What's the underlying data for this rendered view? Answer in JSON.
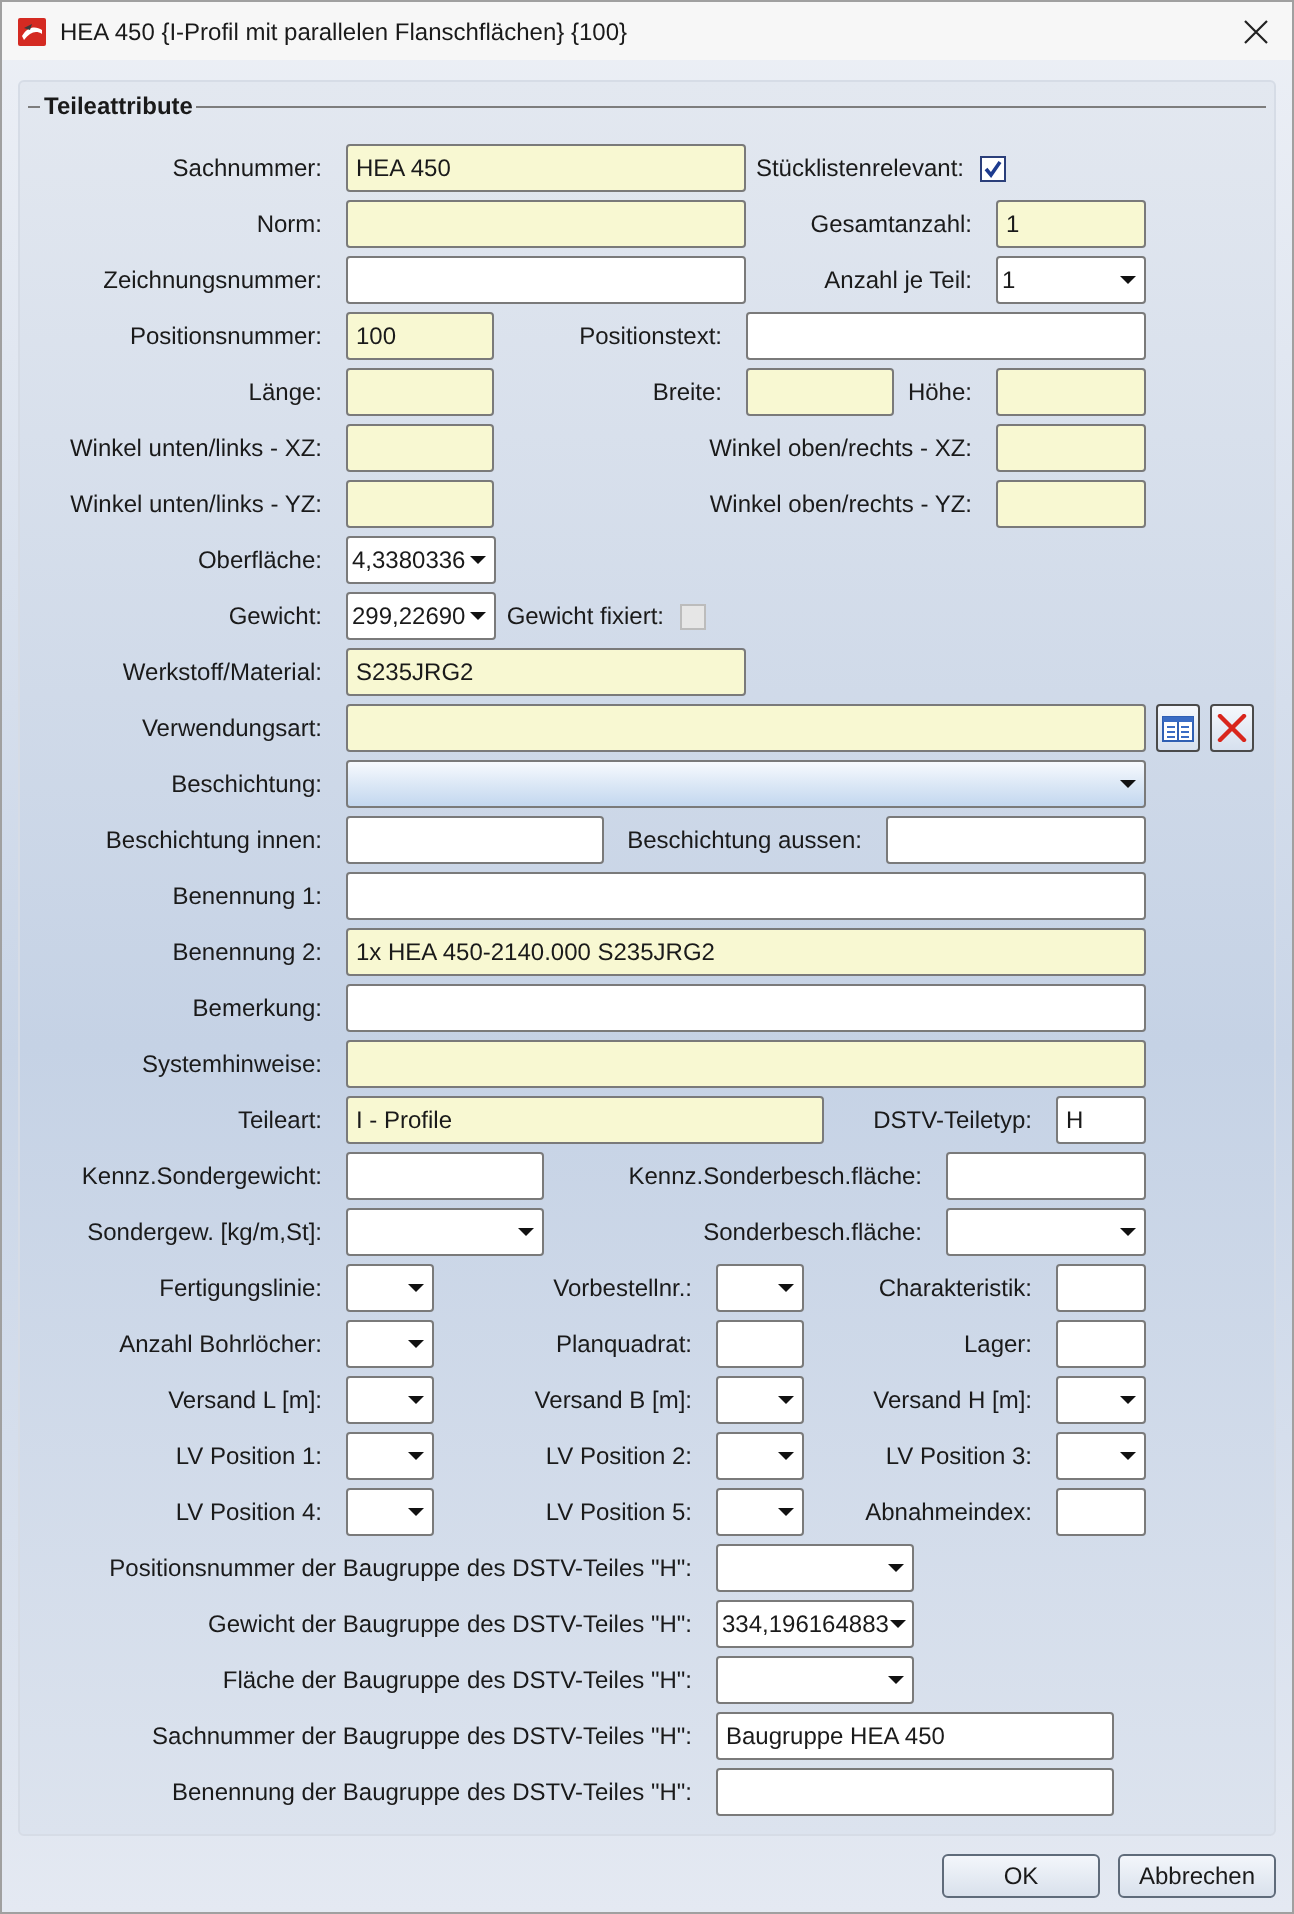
{
  "window": {
    "title": "HEA 450 {I-Profil mit parallelen Flanschflächen} {100}"
  },
  "group": {
    "title": "Teileattribute"
  },
  "rows": [
    {
      "fields": [
        {
          "label": "Sachnummer:",
          "kind": "text",
          "value": "HEA 450",
          "highlighted": true
        },
        {
          "label": "Stücklistenrelevant:",
          "kind": "check",
          "checked": true,
          "disabled": false
        }
      ]
    },
    {
      "fields": [
        {
          "label": "Norm:",
          "kind": "text",
          "highlighted": true
        },
        {
          "label": "Gesamtanzahl:",
          "kind": "text",
          "value": "1",
          "highlighted": true
        }
      ]
    },
    {
      "fields": [
        {
          "label": "Zeichnungsnummer:",
          "kind": "text",
          "highlighted": false
        },
        {
          "label": "Anzahl je Teil:",
          "kind": "combo",
          "value": "1",
          "focused": false
        }
      ]
    },
    {
      "fields": [
        {
          "label": "Positionsnummer:",
          "kind": "text",
          "value": "100",
          "highlighted": true
        },
        {
          "label": "Positionstext:",
          "kind": "text",
          "highlighted": false
        }
      ]
    },
    {
      "fields": [
        {
          "label": "Länge:",
          "kind": "text",
          "highlighted": true
        },
        {
          "label": "Breite:",
          "kind": "text",
          "highlighted": true
        },
        {
          "label": "Höhe:",
          "kind": "text",
          "highlighted": true
        }
      ]
    },
    {
      "fields": [
        {
          "label": "Winkel unten/links - XZ:",
          "kind": "text",
          "highlighted": true
        },
        {
          "label": "Winkel oben/rechts - XZ:",
          "kind": "text",
          "highlighted": true
        }
      ]
    },
    {
      "fields": [
        {
          "label": "Winkel unten/links - YZ:",
          "kind": "text",
          "highlighted": true
        },
        {
          "label": "Winkel oben/rechts - YZ:",
          "kind": "text",
          "highlighted": true
        }
      ]
    },
    {
      "fields": [
        {
          "label": "Oberfläche:",
          "kind": "combo",
          "value": "4,3380336",
          "focused": false
        }
      ]
    },
    {
      "fields": [
        {
          "label": "Gewicht:",
          "kind": "combo",
          "value": "299,22690",
          "focused": false
        },
        {
          "label": "Gewicht fixiert:",
          "kind": "check",
          "checked": false,
          "disabled": true
        }
      ]
    },
    {
      "fields": [
        {
          "label": "Werkstoff/Material:",
          "kind": "text",
          "value": "S235JRG2",
          "highlighted": true
        }
      ]
    },
    {
      "fields": [
        {
          "label": "Verwendungsart:",
          "kind": "text",
          "highlighted": true
        },
        {
          "kind": "picker"
        },
        {
          "kind": "clear"
        }
      ]
    },
    {
      "fields": [
        {
          "label": "Beschichtung:",
          "kind": "combo",
          "focused": true
        }
      ]
    },
    {
      "fields": [
        {
          "label": "Beschichtung innen:",
          "kind": "text",
          "highlighted": false
        },
        {
          "label": "Beschichtung aussen:",
          "kind": "text",
          "highlighted": false
        }
      ]
    },
    {
      "fields": [
        {
          "label": "Benennung 1:",
          "kind": "text",
          "highlighted": false
        }
      ]
    },
    {
      "fields": [
        {
          "label": "Benennung 2:",
          "kind": "text",
          "value": "1x HEA 450-2140.000 S235JRG2",
          "highlighted": true
        }
      ]
    },
    {
      "fields": [
        {
          "label": "Bemerkung:",
          "kind": "text",
          "highlighted": false
        }
      ]
    },
    {
      "fields": [
        {
          "label": "Systemhinweise:",
          "kind": "text",
          "highlighted": true
        }
      ]
    },
    {
      "fields": [
        {
          "label": "Teileart:",
          "kind": "text",
          "value": "I - Profile",
          "highlighted": true
        },
        {
          "label": "DSTV-Teiletyp:",
          "kind": "text",
          "value": "H",
          "highlighted": false
        }
      ]
    },
    {
      "fields": [
        {
          "label": "Kennz.Sondergewicht:",
          "kind": "text",
          "highlighted": false
        },
        {
          "label": "Kennz.Sonderbesch.fläche:",
          "kind": "text",
          "highlighted": false
        }
      ]
    },
    {
      "fields": [
        {
          "label": "Sondergew. [kg/m,St]:",
          "kind": "combo",
          "focused": false
        },
        {
          "label": "Sonderbesch.fläche:",
          "kind": "combo",
          "focused": false
        }
      ]
    },
    {
      "fields": [
        {
          "label": "Fertigungslinie:",
          "kind": "combo",
          "focused": false
        },
        {
          "label": "Vorbestellnr.:",
          "kind": "combo",
          "focused": false
        },
        {
          "label": "Charakteristik:",
          "kind": "text",
          "highlighted": false
        }
      ]
    },
    {
      "fields": [
        {
          "label": "Anzahl Bohrlöcher:",
          "kind": "combo",
          "focused": false
        },
        {
          "label": "Planquadrat:",
          "kind": "text",
          "highlighted": false
        },
        {
          "label": "Lager:",
          "kind": "text",
          "highlighted": false
        }
      ]
    },
    {
      "fields": [
        {
          "label": "Versand L [m]:",
          "kind": "combo",
          "focused": false
        },
        {
          "label": "Versand B [m]:",
          "kind": "combo",
          "focused": false
        },
        {
          "label": "Versand H [m]:",
          "kind": "combo",
          "focused": false
        }
      ]
    },
    {
      "fields": [
        {
          "label": "LV Position 1:",
          "kind": "combo",
          "focused": false
        },
        {
          "label": "LV Position 2:",
          "kind": "combo",
          "focused": false
        },
        {
          "label": "LV Position 3:",
          "kind": "combo",
          "focused": false
        }
      ]
    },
    {
      "fields": [
        {
          "label": "LV Position 4:",
          "kind": "combo",
          "focused": false
        },
        {
          "label": "LV Position 5:",
          "kind": "combo",
          "focused": false
        },
        {
          "label": "Abnahmeindex:",
          "kind": "text",
          "highlighted": false
        }
      ]
    },
    {
      "fields": [
        {
          "label": "Positionsnummer der Baugruppe des DSTV-Teiles \"H\":",
          "kind": "combo",
          "focused": false
        }
      ]
    },
    {
      "fields": [
        {
          "label": "Gewicht der Baugruppe des DSTV-Teiles \"H\":",
          "kind": "combo",
          "value": "334,196164883",
          "focused": false
        }
      ]
    },
    {
      "fields": [
        {
          "label": "Fläche der Baugruppe des DSTV-Teiles \"H\":",
          "kind": "combo",
          "focused": false
        }
      ]
    },
    {
      "fields": [
        {
          "label": "Sachnummer der Baugruppe des DSTV-Teiles \"H\":",
          "kind": "text",
          "value": "Baugruppe HEA 450",
          "highlighted": false
        }
      ]
    },
    {
      "fields": [
        {
          "label": "Benennung der Baugruppe des DSTV-Teiles \"H\":",
          "kind": "text",
          "highlighted": false
        }
      ]
    }
  ],
  "buttons": [
    {
      "label": "OK"
    },
    {
      "label": "Abbrechen"
    }
  ]
}
